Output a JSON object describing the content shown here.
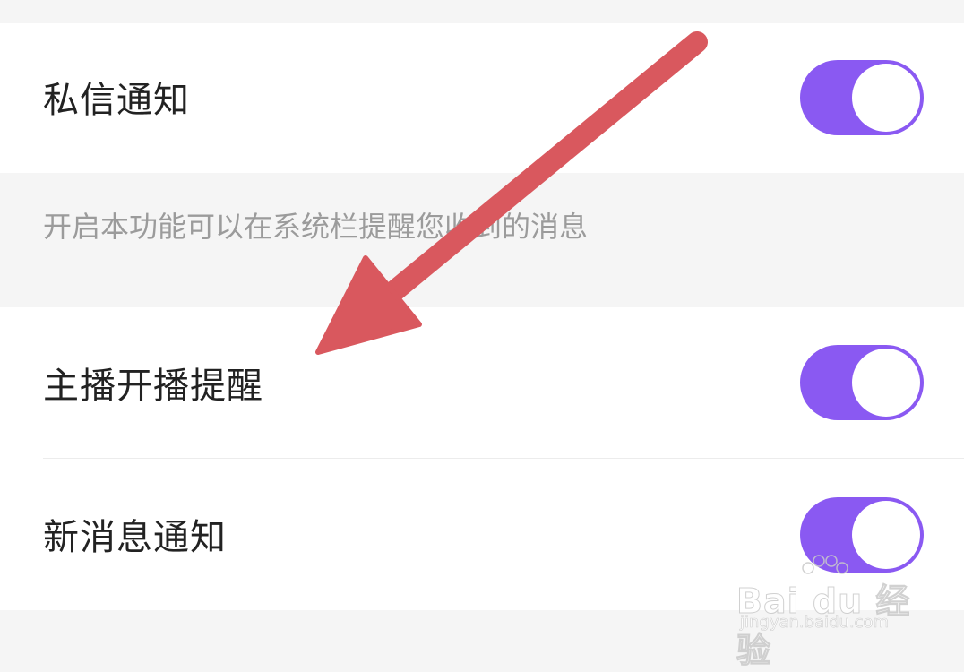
{
  "settings": {
    "rows": [
      {
        "label": "私信通知",
        "enabled": true
      },
      {
        "label": "主播开播提醒",
        "enabled": true
      },
      {
        "label": "新消息通知",
        "enabled": true
      }
    ],
    "hint": "开启本功能可以在系统栏提醒您收到的消息"
  },
  "colors": {
    "toggle_on": "#8a59f2",
    "knob": "#ffffff",
    "arrow": "#d9585e",
    "page_bg": "#f5f5f5",
    "card_bg": "#ffffff"
  },
  "watermark": {
    "logo_text": "Bai du 经验",
    "url": "jingyan.baidu.com"
  }
}
